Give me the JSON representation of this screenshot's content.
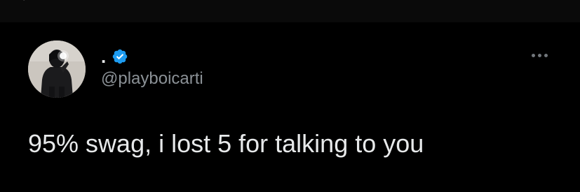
{
  "tweet": {
    "author": {
      "display_name": ".",
      "handle": "@playboicarti",
      "verified": true,
      "avatar_icon": "profile-photo"
    },
    "text": "95% swag, i lost 5 for talking to you",
    "more_icon": "more-options-icon"
  },
  "colors": {
    "background": "#000000",
    "text_primary": "#e7e9ea",
    "text_secondary": "#8b9196",
    "verified_blue": "#1d9bf0"
  }
}
